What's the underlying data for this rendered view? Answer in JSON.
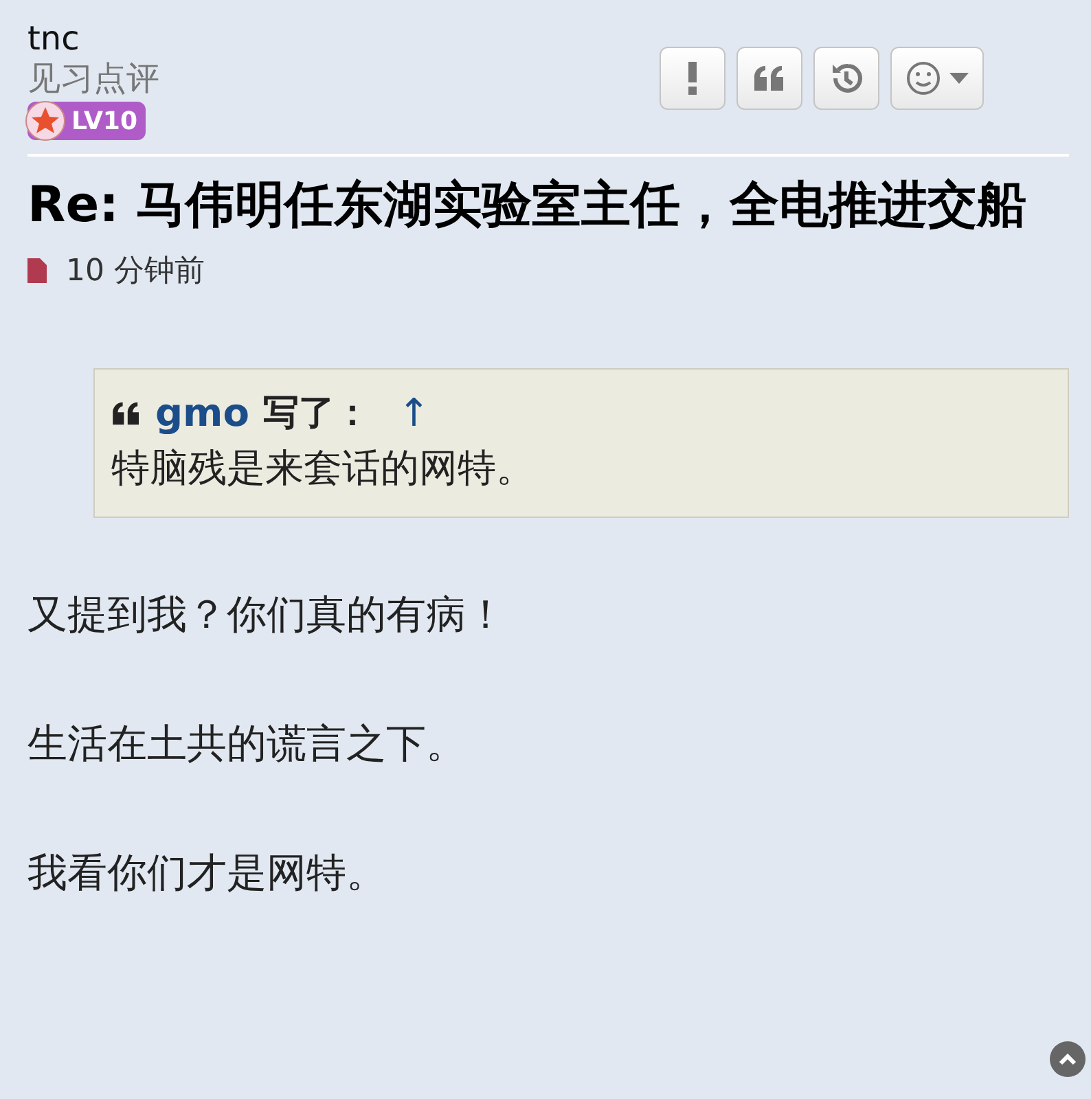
{
  "author": {
    "name": "tnc",
    "rank": "见习点评",
    "badge": "LV10"
  },
  "title": "Re: 马伟明任东湖实验室主任，全电推进交船",
  "time": "10 分钟前",
  "quote": {
    "author": "gmo",
    "says": "写了：",
    "arrow": "↑",
    "text": "特脑残是来套话的网特。"
  },
  "paragraphs": [
    "又提到我？你们真的有病！",
    "生活在土共的谎言之下。",
    "我看你们才是网特。"
  ]
}
